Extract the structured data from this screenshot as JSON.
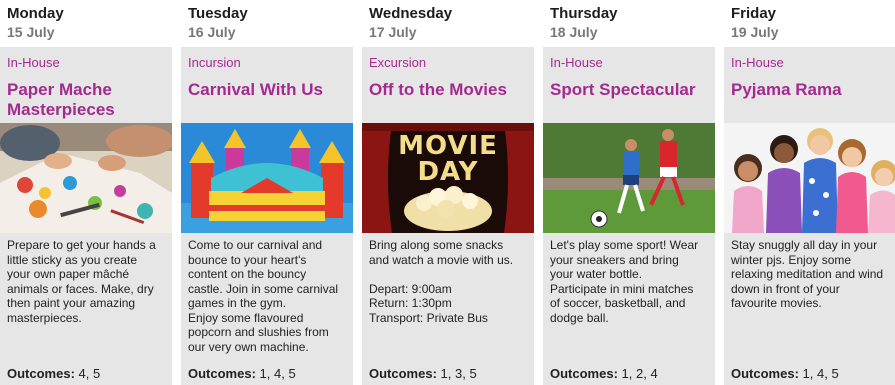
{
  "days": [
    {
      "day": "Monday",
      "date": "15 July",
      "type": "In-House",
      "title": "Paper Mache Masterpieces",
      "description": "Prepare to get your hands a little sticky as you create your own paper mâché animals or faces. Make, dry then paint your amazing masterpieces.",
      "outcomes_label": "Outcomes:",
      "outcomes": "4, 5"
    },
    {
      "day": "Tuesday",
      "date": "16 July",
      "type": "Incursion",
      "title": "Carnival With Us",
      "description": "Come to our carnival and bounce to your heart's content on the bouncy castle. Join in some carnival games in the gym. Enjoy some flavoured popcorn and slushies from our very own machine.",
      "outcomes_label": "Outcomes:",
      "outcomes": "1, 4, 5"
    },
    {
      "day": "Wednesday",
      "date": "17 July",
      "type": "Excursion",
      "title": "Off to the Movies",
      "description": "Bring along some snacks and watch a movie with us. Depart: 9:00am Return: 1:30pm Transport: Private Bus",
      "image_text": "MOVIE DAY",
      "outcomes_label": "Outcomes:",
      "outcomes": "1, 3, 5"
    },
    {
      "day": "Thursday",
      "date": "18 July",
      "type": "In-House",
      "title": "Sport Spectacular",
      "description": "Let's play some sport! Wear your sneakers and bring your water bottle. Participate in mini matches of soccer, basketball, and dodge ball.",
      "outcomes_label": "Outcomes:",
      "outcomes": "1, 2, 4"
    },
    {
      "day": "Friday",
      "date": "19 July",
      "type": "In-House",
      "title": "Pyjama Rama",
      "description": "Stay snuggly all day in your winter pjs. Enjoy some relaxing meditation and wind down in front of your favourite movies.",
      "outcomes_label": "Outcomes:",
      "outcomes": "1, 4, 5"
    }
  ]
}
